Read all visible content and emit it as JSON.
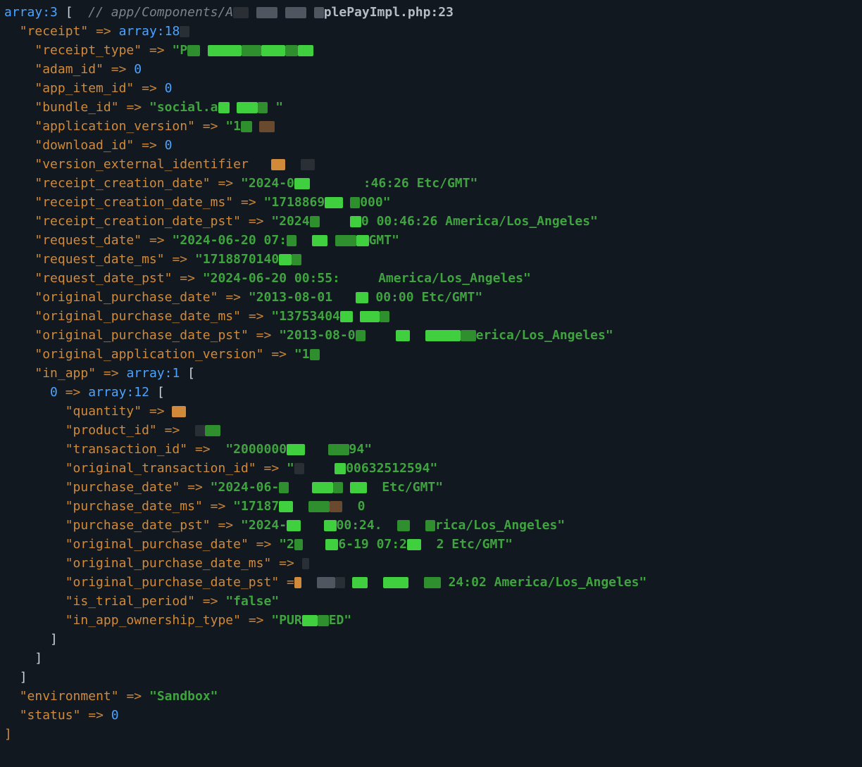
{
  "header": {
    "array_kw": "array",
    "count": "3",
    "bracket_open": "[",
    "comment_prefix": "// app/Components/A",
    "comment_suffix": "plePayImpl.php:23"
  },
  "receipt_key": "receipt",
  "receipt_arr": "array",
  "receipt_count": "18",
  "keys": {
    "receipt_type": "receipt_type",
    "adam_id": "adam_id",
    "app_item_id": "app_item_id",
    "bundle_id": "bundle_id",
    "application_version": "application_version",
    "download_id": "download_id",
    "version_external_identifier": "version_external_identifier",
    "receipt_creation_date": "receipt_creation_date",
    "receipt_creation_date_ms": "receipt_creation_date_ms",
    "receipt_creation_date_pst": "receipt_creation_date_pst",
    "request_date": "request_date",
    "request_date_ms": "request_date_ms",
    "request_date_pst": "request_date_pst",
    "original_purchase_date": "original_purchase_date",
    "original_purchase_date_ms": "original_purchase_date_ms",
    "original_purchase_date_pst": "original_purchase_date_pst",
    "original_application_version": "original_application_version",
    "in_app": "in_app"
  },
  "vals": {
    "zero": "0",
    "receipt_type_pre": "P",
    "bundle_id_pre": "social.a",
    "app_ver_pre": "1",
    "rcd_a": "2024-0",
    "rcd_b": ":46:26 Etc/GMT",
    "rcdms_a": "1718869",
    "rcdms_b": "000",
    "rcdpst_a": "2024",
    "rcdpst_b": "0 00:46:26 America/Los_Angeles",
    "reqd_a": "2024-06-20 07:",
    "reqd_b": "GMT",
    "reqdms_a": "1718870140",
    "reqdpst_a": "2024-06-20 00:55:",
    "reqdpst_b": "America/Los_Angeles",
    "opd_a": "2013-08-01",
    "opd_b": "00:00 Etc/GMT",
    "opdms_a": "13753404",
    "opdpst_a": "2013-08-0",
    "opdpst_b": "erica/Los_Angeles",
    "oav_a": "1"
  },
  "inapp": {
    "arr": "array",
    "count1": "1",
    "idx0": "0",
    "count12": "12",
    "keys": {
      "quantity": "quantity",
      "product_id": "product_id",
      "transaction_id": "transaction_id",
      "original_transaction_id": "original_transaction_id",
      "purchase_date": "purchase_date",
      "purchase_date_ms": "purchase_date_ms",
      "purchase_date_pst": "purchase_date_pst",
      "original_purchase_date": "original_purchase_date",
      "original_purchase_date_ms": "original_purchase_date_ms",
      "original_purchase_date_pst": "original_purchase_date_pst",
      "is_trial_period": "is_trial_period",
      "in_app_ownership_type": "in_app_ownership_type"
    },
    "vals": {
      "tid_a": "2000000",
      "tid_b": "94",
      "otid_b": "00632512594",
      "pd_a": "2024-06-",
      "pd_b": "Etc/GMT",
      "pdms_a": "17187",
      "pdms_b": "0",
      "pdpst_a": "2024-",
      "pdpst_b": "00:24",
      "pdpst_c": "rica/Los_Angeles",
      "opd_a": "2",
      "opd_b": "6-19 07:2",
      "opd_c": "2 Etc/GMT",
      "opdpst_b": "24:02 America/Los_Angeles",
      "trial": "false",
      "own_a": "PUR",
      "own_b": "ED"
    }
  },
  "env_key": "environment",
  "env_val": "Sandbox",
  "status_key": "status",
  "arrow": "=>",
  "q": "\"",
  "bopen": "[",
  "bclose": "]"
}
